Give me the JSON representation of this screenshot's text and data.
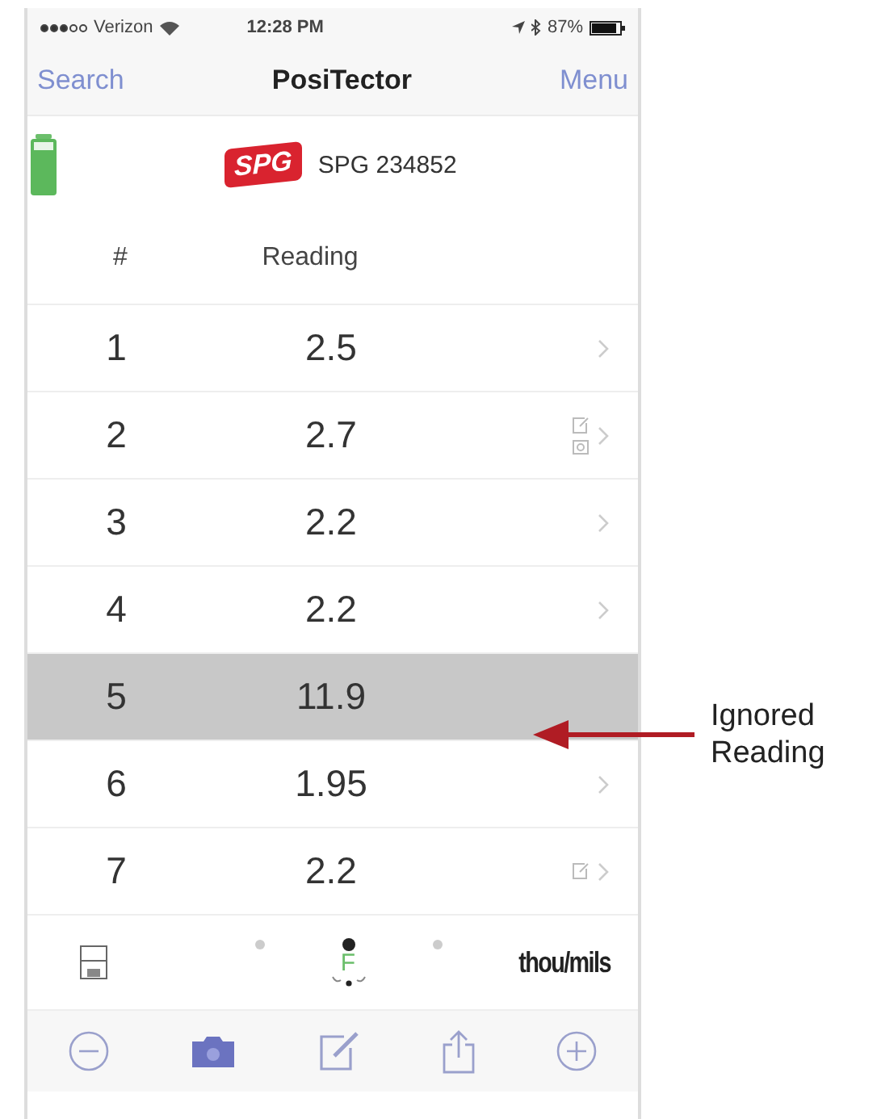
{
  "status_bar": {
    "carrier": "Verizon",
    "time": "12:28 PM",
    "battery": "87%"
  },
  "nav": {
    "left": "Search",
    "title": "PosiTector",
    "right": "Menu"
  },
  "device": {
    "logo": "SPG",
    "name": "SPG 234852"
  },
  "columns": [
    "#",
    "Reading"
  ],
  "rows": [
    {
      "number": "1",
      "reading": "2.5",
      "ignored": false,
      "note": false,
      "photo": false
    },
    {
      "number": "2",
      "reading": "2.7",
      "ignored": false,
      "note": true,
      "photo": true
    },
    {
      "number": "3",
      "reading": "2.2",
      "ignored": false,
      "note": false,
      "photo": false
    },
    {
      "number": "4",
      "reading": "2.2",
      "ignored": false,
      "note": false,
      "photo": false
    },
    {
      "number": "5",
      "reading": "11.9",
      "ignored": true,
      "note": false,
      "photo": false
    },
    {
      "number": "6",
      "reading": "1.95",
      "ignored": false,
      "note": false,
      "photo": false
    },
    {
      "number": "7",
      "reading": "2.2",
      "ignored": false,
      "note": true,
      "photo": false
    }
  ],
  "page_dots": [
    {
      "selected": false
    },
    {
      "selected": true
    },
    {
      "selected": false
    }
  ],
  "probe": {
    "letter": "F"
  },
  "units": "thou/mils",
  "annotation": {
    "text": "Ignored Reading"
  }
}
